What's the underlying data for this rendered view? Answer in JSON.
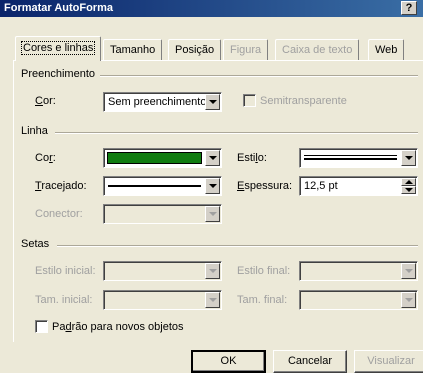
{
  "window": {
    "title": "Formatar AutoForma",
    "help_label": "?"
  },
  "tabs": [
    {
      "label": "Cores e linhas",
      "state": "active"
    },
    {
      "label": "Tamanho",
      "state": "normal"
    },
    {
      "label": "Posição",
      "state": "normal"
    },
    {
      "label": "Figura",
      "state": "disabled"
    },
    {
      "label": "Caixa de texto",
      "state": "disabled"
    },
    {
      "label": "Web",
      "state": "normal"
    }
  ],
  "fill": {
    "section_label": "Preenchimento",
    "color_label_key": "C",
    "color_label_rest": "or:",
    "color_value": "Sem preenchimento",
    "semitransparent_label": "Semitransparente",
    "semitransparent_checked": false
  },
  "line": {
    "section_label": "Linha",
    "color_label_pre": "Co",
    "color_label_key": "r",
    "color_label_post": ":",
    "color_swatch": "#107c10",
    "dashed_label_key": "T",
    "dashed_label_rest": "racejado:",
    "style_label_pre": "Esti",
    "style_label_key": "l",
    "style_label_post": "o:",
    "weight_label_key": "E",
    "weight_label_rest": "spessura:",
    "weight_value": "12,5 pt",
    "connector_label": "Conector:"
  },
  "arrows": {
    "section_label": "Setas",
    "begin_style_label": "Estilo inicial:",
    "end_style_label": "Estilo final:",
    "begin_size_label": "Tam. inicial:",
    "end_size_label": "Tam. final:"
  },
  "default_checkbox": {
    "label_pre": "Pa",
    "label_key": "d",
    "label_post": "rão para novos objetos",
    "checked": false
  },
  "buttons": {
    "ok": "OK",
    "cancel": "Cancelar",
    "preview": "Visualizar"
  },
  "colors": {
    "title_bar": "#0a246a",
    "dialog_bg": "#ece9d8",
    "line_color": "#107c10",
    "disabled_text": "#a0a0a0"
  }
}
